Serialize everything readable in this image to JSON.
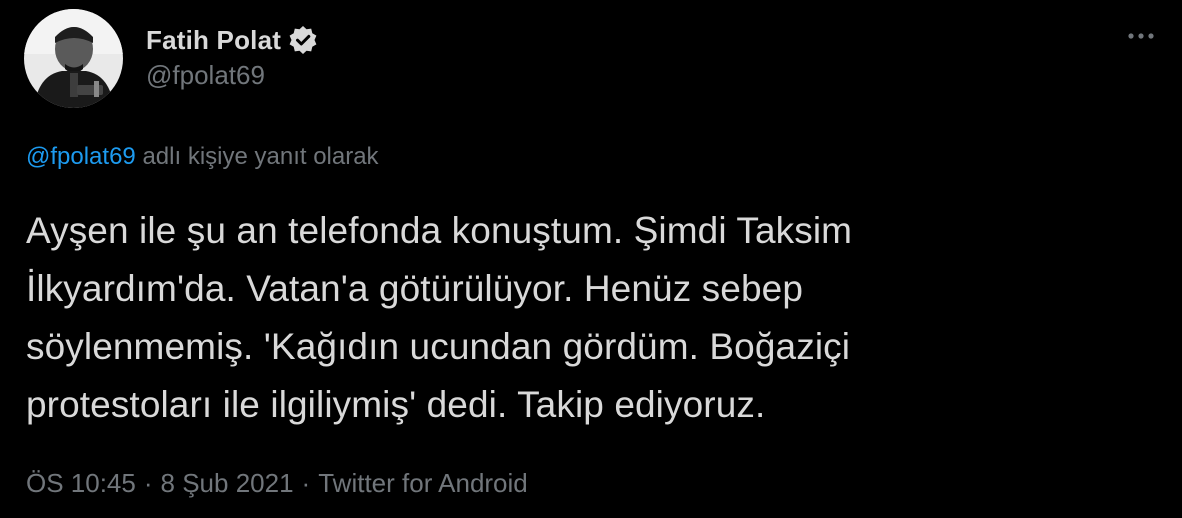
{
  "author": {
    "display_name": "Fatih Polat",
    "handle": "@fpolat69",
    "verified": true
  },
  "reply_context": {
    "mention": "@fpolat69",
    "suffix": " adlı kişiye yanıt olarak"
  },
  "tweet": {
    "lines": [
      "Ayşen ile şu an telefonda konuştum. Şimdi Taksim",
      "İlkyardım'da. Vatan'a götürülüyor. Henüz sebep",
      "söylenmemiş. 'Kağıdın ucundan gördüm. Boğaziçi",
      "protestoları ile ilgiliymiş' dedi. Takip ediyoruz."
    ]
  },
  "meta": {
    "time": "ÖS 10:45",
    "date": "8 Şub 2021",
    "source": "Twitter for Android",
    "separator": "·"
  },
  "icons": {
    "verified": "verified-badge-icon",
    "more": "more-horizontal-icon"
  },
  "colors": {
    "background": "#000000",
    "link": "#1d9bf0",
    "muted": "#71767b",
    "text": "#d9d9d9"
  }
}
